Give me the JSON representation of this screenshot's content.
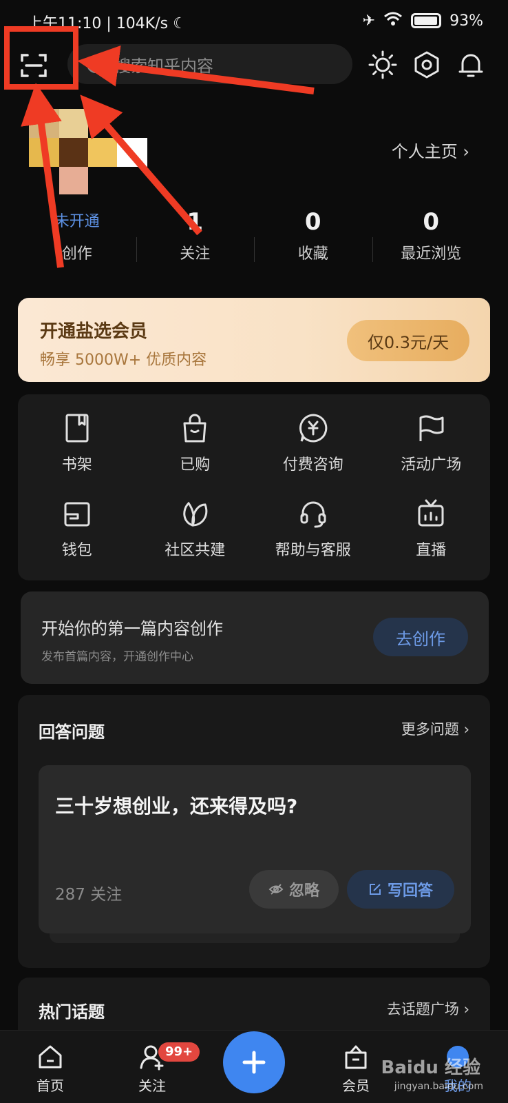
{
  "status": {
    "time": "上午11:10",
    "speed": "104K/s",
    "battery": "93%"
  },
  "header": {
    "search_placeholder": "搜索知乎内容"
  },
  "profile": {
    "homepage": "个人主页 ›"
  },
  "stats": [
    {
      "value": "未开通",
      "label": "创作"
    },
    {
      "value": "1",
      "label": "关注"
    },
    {
      "value": "0",
      "label": "收藏"
    },
    {
      "value": "0",
      "label": "最近浏览"
    }
  ],
  "vip": {
    "title": "开通盐选会员",
    "subtitle": "畅享 5000W+ 优质内容",
    "button": "仅0.3元/天"
  },
  "grid": [
    {
      "label": "书架",
      "icon": "bookshelf-icon"
    },
    {
      "label": "已购",
      "icon": "bag-icon"
    },
    {
      "label": "付费咨询",
      "icon": "yuan-chat-icon"
    },
    {
      "label": "活动广场",
      "icon": "flag-icon"
    },
    {
      "label": "钱包",
      "icon": "wallet-icon"
    },
    {
      "label": "社区共建",
      "icon": "leaf-icon"
    },
    {
      "label": "帮助与客服",
      "icon": "headset-icon"
    },
    {
      "label": "直播",
      "icon": "tv-icon"
    }
  ],
  "create": {
    "title": "开始你的第一篇内容创作",
    "subtitle": "发布首篇内容，开通创作中心",
    "button": "去创作"
  },
  "answer": {
    "title": "回答问题",
    "more": "更多问题 ›",
    "question": "三十岁想创业，还来得及吗?",
    "follow": "287 关注",
    "ignore": "忽略",
    "write": "写回答"
  },
  "hot": {
    "title": "热门话题",
    "more": "去话题广场 ›"
  },
  "tabs": {
    "home": "首页",
    "follow": "关注",
    "badge": "99+",
    "member": "会员",
    "mine": "我的"
  },
  "watermark": {
    "brand": "Baidu 经验",
    "url": "jingyan.baidu.com"
  },
  "colors": {
    "accent": "#3f86f0",
    "highlight": "#ef3b24",
    "vip_bg": "#fbe8d4"
  }
}
